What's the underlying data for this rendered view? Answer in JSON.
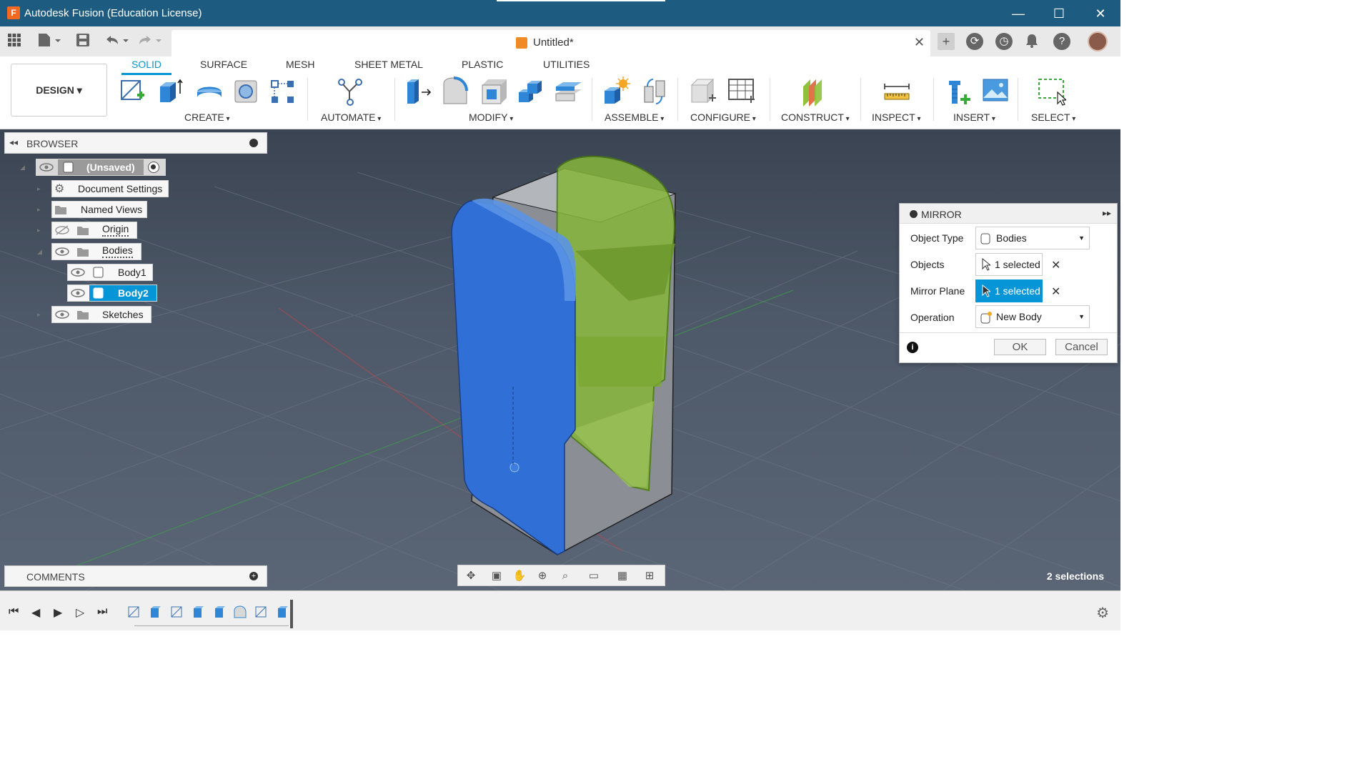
{
  "window": {
    "app_icon_text": "F",
    "title": "Autodesk Fusion (Education License)",
    "minimize": "—",
    "maximize": "☐",
    "close": "✕"
  },
  "document": {
    "title": "Untitled*",
    "close": "✕"
  },
  "ribbon": {
    "workspace": "DESIGN ▾",
    "tabs": [
      "SOLID",
      "SURFACE",
      "MESH",
      "SHEET METAL",
      "PLASTIC",
      "UTILITIES"
    ],
    "active_tab": "SOLID",
    "groups": [
      "CREATE",
      "AUTOMATE",
      "MODIFY",
      "ASSEMBLE",
      "CONFIGURE",
      "CONSTRUCT",
      "INSPECT",
      "INSERT",
      "SELECT"
    ]
  },
  "browser": {
    "title": "BROWSER",
    "root": "(Unsaved)",
    "items": [
      {
        "label": "Document Settings"
      },
      {
        "label": "Named Views"
      },
      {
        "label": "Origin"
      },
      {
        "label": "Bodies"
      },
      {
        "label": "Body1"
      },
      {
        "label": "Body2"
      },
      {
        "label": "Sketches"
      }
    ]
  },
  "mirror": {
    "title": "MIRROR",
    "object_type_label": "Object Type",
    "object_type_value": "Bodies",
    "objects_label": "Objects",
    "objects_value": "1 selected",
    "mirror_plane_label": "Mirror Plane",
    "mirror_plane_value": "1 selected",
    "operation_label": "Operation",
    "operation_value": "New Body",
    "ok": "OK",
    "cancel": "Cancel",
    "info": "i"
  },
  "comments": {
    "title": "COMMENTS"
  },
  "status": {
    "selections": "2 selections"
  },
  "colors": {
    "titlebar": "#1d5c80",
    "accent": "#0696d7",
    "body_blue": "#2f6fd6",
    "body_green": "#8fc23a"
  }
}
